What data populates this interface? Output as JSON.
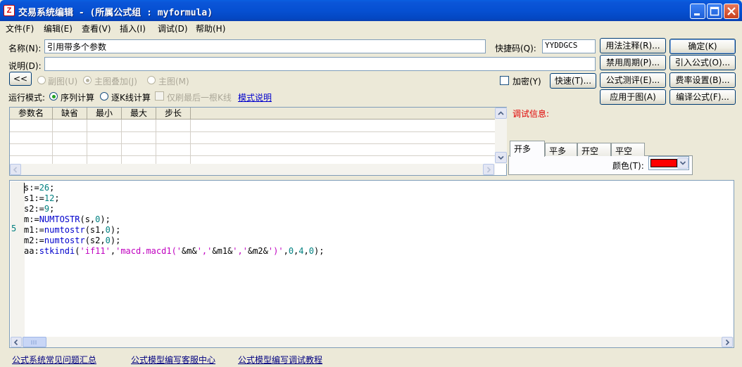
{
  "window": {
    "title": "交易系统编辑 - (所属公式组 : myformula)",
    "app_icon": "Z"
  },
  "menu": [
    "文件(F)",
    "编辑(E)",
    "查看(V)",
    "插入(I)",
    "调试(D)",
    "帮助(H)"
  ],
  "form": {
    "name_label": "名称(N):",
    "name_value": "引用带多个参数",
    "shortcut_label": "快捷码(Q):",
    "shortcut_value": "YYDDGCS",
    "desc_label": "说明(D):",
    "desc_value": "",
    "nav_prev": "<<",
    "chart_options": [
      {
        "label": "副图(U)",
        "checked": false
      },
      {
        "label": "主图叠加(J)",
        "checked": true
      },
      {
        "label": "主图(M)",
        "checked": false
      }
    ],
    "encrypt_label": "加密(Y)",
    "quick_label": "快速(T)...",
    "run_mode_label": "运行模式:",
    "run_modes": [
      {
        "label": "序列计算",
        "checked": true
      },
      {
        "label": "逐K线计算",
        "checked": false
      }
    ],
    "last_bar_label": "仅刷最后一根K线",
    "mode_help_link": "模式说明"
  },
  "buttons": {
    "usage_notes": "用法注释(R)...",
    "ok": "确定(K)",
    "disabled_periods": "禁用周期(P)...",
    "import_formula": "引入公式(O)...",
    "formula_test": "公式测评(E)...",
    "fee_settings": "费率设置(B)...",
    "apply_to_chart": "应用于图(A)",
    "compile": "编译公式(F)..."
  },
  "param_table": {
    "columns": [
      "参数名",
      "缺省",
      "最小",
      "最大",
      "步长"
    ],
    "rows": []
  },
  "debug": {
    "label": "调试信息:",
    "tabs": [
      "开多",
      "平多",
      "开空",
      "平空"
    ],
    "active_tab": "开多",
    "color_label": "颜色(T):",
    "color_value": "#ff0000"
  },
  "editor": {
    "line_marker": "5",
    "lines": [
      [
        {
          "t": "s:=",
          "c": "var"
        },
        {
          "t": "26",
          "c": "num"
        },
        {
          "t": ";",
          "c": "var"
        }
      ],
      [
        {
          "t": "s1:=",
          "c": "var"
        },
        {
          "t": "12",
          "c": "num"
        },
        {
          "t": ";",
          "c": "var"
        }
      ],
      [
        {
          "t": "s2:=",
          "c": "var"
        },
        {
          "t": "9",
          "c": "num"
        },
        {
          "t": ";",
          "c": "var"
        }
      ],
      [
        {
          "t": "m:=",
          "c": "var"
        },
        {
          "t": "NUMTOSTR",
          "c": "fn"
        },
        {
          "t": "(s,",
          "c": "var"
        },
        {
          "t": "0",
          "c": "num"
        },
        {
          "t": ");",
          "c": "var"
        }
      ],
      [
        {
          "t": "m1:=",
          "c": "var"
        },
        {
          "t": "numtostr",
          "c": "fn"
        },
        {
          "t": "(s1,",
          "c": "var"
        },
        {
          "t": "0",
          "c": "num"
        },
        {
          "t": ");",
          "c": "var"
        }
      ],
      [
        {
          "t": "m2:=",
          "c": "var"
        },
        {
          "t": "numtostr",
          "c": "fn"
        },
        {
          "t": "(s2,",
          "c": "var"
        },
        {
          "t": "0",
          "c": "num"
        },
        {
          "t": ");",
          "c": "var"
        }
      ],
      [
        {
          "t": "aa:",
          "c": "var"
        },
        {
          "t": "stkindi",
          "c": "fn"
        },
        {
          "t": "(",
          "c": "var"
        },
        {
          "t": "'if11'",
          "c": "str"
        },
        {
          "t": ",",
          "c": "var"
        },
        {
          "t": "'macd.macd1('",
          "c": "str"
        },
        {
          "t": "&m&",
          "c": "var"
        },
        {
          "t": "','",
          "c": "str"
        },
        {
          "t": "&m1&",
          "c": "var"
        },
        {
          "t": "','",
          "c": "str"
        },
        {
          "t": "&m2&",
          "c": "var"
        },
        {
          "t": "')'",
          "c": "str"
        },
        {
          "t": ",",
          "c": "var"
        },
        {
          "t": "0",
          "c": "num"
        },
        {
          "t": ",",
          "c": "var"
        },
        {
          "t": "4",
          "c": "num"
        },
        {
          "t": ",",
          "c": "var"
        },
        {
          "t": "0",
          "c": "num"
        },
        {
          "t": ");",
          "c": "var"
        }
      ]
    ]
  },
  "footer_links": [
    "公式系统常见问题汇总",
    "公式模型编写客服中心",
    "公式模型编写调试教程"
  ]
}
